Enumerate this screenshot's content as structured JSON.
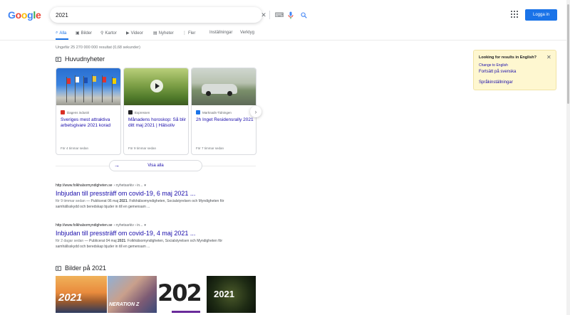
{
  "logo": {
    "text": "Google"
  },
  "search": {
    "query": "2021"
  },
  "header": {
    "login_label": "Logga in"
  },
  "tabs": [
    {
      "label": "Alla",
      "icon": "search-icon"
    },
    {
      "label": "Bilder",
      "icon": "image-icon"
    },
    {
      "label": "Kartor",
      "icon": "map-pin-icon"
    },
    {
      "label": "Videor",
      "icon": "play-icon"
    },
    {
      "label": "Nyheter",
      "icon": "news-icon"
    },
    {
      "label": "Fler",
      "icon": "more-icon"
    },
    {
      "label": "Inställningar",
      "icon": ""
    },
    {
      "label": "Verktyg",
      "icon": ""
    }
  ],
  "result_stats": "Ungefär 25 270 000 000 resultat (0,68 sekunder)",
  "top_stories": {
    "heading": "Huvudnyheter",
    "cards": [
      {
        "source": "Dagens industri",
        "title": "Sveriges mest attraktiva arbetsgivare 2021 korad",
        "time": "För 4 timmar sedan",
        "fav_color": "#d93025"
      },
      {
        "source": "Expressen",
        "title": "Månadens horoskop: Så blir ditt maj 2021 | Hälsoliv",
        "time": "För 9 timmar sedan",
        "fav_color": "#202124"
      },
      {
        "source": "Marknads-Tidningen",
        "title": "2h Inget Residensrally 2021",
        "time": "För 7 timmar sedan",
        "fav_color": "#1a73e8"
      }
    ],
    "show_all": "Visa alla"
  },
  "results": [
    {
      "url": "http://www.folkhalsomyndigheten.se",
      "crumb": "› nyhetsarkiv › in...",
      "title": "Inbjudan till pressträff om covid-19, 6 maj 2021 ...",
      "date": "för 9 timmar sedan",
      "snippet_pre": " — Publicerat 06 maj ",
      "snippet_bold": "2021",
      "snippet_post": ". Folkhälsomyndigheten, Socialstyrelsen och Myndigheten för samhällsskydd och beredskap bjuder in till en gemensam ..."
    },
    {
      "url": "http://www.folkhalsomyndigheten.se",
      "crumb": "› nyhetsarkiv › in...",
      "title": "Inbjudan till pressträff om covid-19, 4 maj 2021 ...",
      "date": "för 2 dagar sedan",
      "snippet_pre": " — Publicerat 04 maj ",
      "snippet_bold": "2021",
      "snippet_post": ". Folkhälsomyndigheten, Socialstyrelsen och Myndigheten för samhällsskydd och beredskap bjuder in till en gemensam ..."
    }
  ],
  "images_section": {
    "heading": "Bilder på 2021",
    "thumbs": [
      {
        "overlay": "2021"
      },
      {
        "overlay": "NERATION Z"
      },
      {
        "overlay": "202"
      },
      {
        "overlay": "2021"
      }
    ]
  },
  "lang_prompt": {
    "question": "Looking for results in English?",
    "change": "Change to English",
    "keep": "Fortsätt på svenska",
    "settings": "Språkinställningar"
  }
}
